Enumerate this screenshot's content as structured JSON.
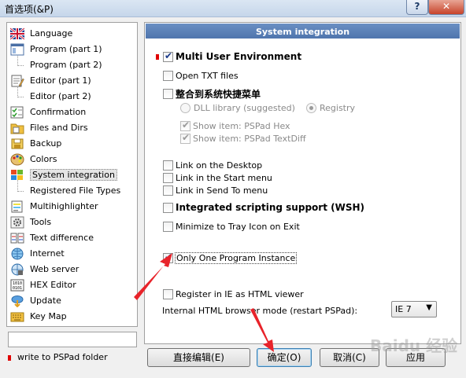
{
  "window": {
    "title": "首选项(&P)",
    "help_label": "?",
    "close_label": "✕"
  },
  "sidebar": {
    "items": [
      {
        "label": "Language",
        "icon": "uk-flag-icon"
      },
      {
        "label": "Program  (part 1)",
        "icon": "program-icon"
      },
      {
        "label": "Program  (part 2)",
        "icon": ""
      },
      {
        "label": "Editor  (part 1)",
        "icon": "editor-icon"
      },
      {
        "label": "Editor  (part 2)",
        "icon": ""
      },
      {
        "label": "Confirmation",
        "icon": "checklist-icon"
      },
      {
        "label": "Files and Dirs",
        "icon": "folder-icon"
      },
      {
        "label": "Backup",
        "icon": "backup-icon"
      },
      {
        "label": "Colors",
        "icon": "palette-icon"
      },
      {
        "label": "System integration",
        "icon": "windows-icon"
      },
      {
        "label": "Registered File Types",
        "icon": ""
      },
      {
        "label": "Multihighlighter",
        "icon": "highlighter-icon"
      },
      {
        "label": "Tools",
        "icon": "gear-icon"
      },
      {
        "label": "Text difference",
        "icon": "diff-icon"
      },
      {
        "label": "Internet",
        "icon": "globe-icon"
      },
      {
        "label": "Web server",
        "icon": "server-icon"
      },
      {
        "label": "HEX Editor",
        "icon": "hex-icon"
      },
      {
        "label": "Update",
        "icon": "update-icon"
      },
      {
        "label": "Key Map",
        "icon": "keyboard-icon"
      }
    ],
    "selected": "System integration",
    "legend": "write to PSPad folder"
  },
  "panel": {
    "title": "System integration",
    "options": {
      "multi_user": {
        "label": "Multi User Environment",
        "checked": true
      },
      "open_txt": {
        "label": "Open TXT files",
        "checked": false
      },
      "shell_menu": {
        "label": "整合到系统快捷菜单",
        "checked": false
      },
      "dll_library": {
        "label": "DLL library (suggested)",
        "checked": false
      },
      "registry": {
        "label": "Registry",
        "checked": true
      },
      "show_hex": {
        "label": "Show item: PSPad Hex",
        "checked": true
      },
      "show_textdiff": {
        "label": "Show item: PSPad TextDiff",
        "checked": true
      },
      "link_desktop": {
        "label": "Link on the Desktop",
        "checked": false
      },
      "link_start": {
        "label": "Link in the Start menu",
        "checked": false
      },
      "link_sendto": {
        "label": "Link in Send To menu",
        "checked": false
      },
      "wsh": {
        "label": "Integrated scripting support (WSH)",
        "checked": false
      },
      "minimize_tray": {
        "label": "Minimize to Tray Icon on Exit",
        "checked": false
      },
      "single_instance": {
        "label": "Only One Program Instance",
        "checked": true
      },
      "register_ie": {
        "label": "Register in IE as HTML viewer",
        "checked": false
      }
    },
    "browser_mode": {
      "label": "Internal HTML browser mode (restart PSPad):",
      "value": "IE 7"
    }
  },
  "buttons": {
    "direct_edit": "直接编辑(E)",
    "ok": "确定(O)",
    "cancel": "取消(C)",
    "apply": "应用"
  },
  "watermark": "Baidu 经验",
  "colors": {
    "accent": "#4f75ad",
    "annotation": "#e8232a",
    "required_marker": "#e00000"
  }
}
